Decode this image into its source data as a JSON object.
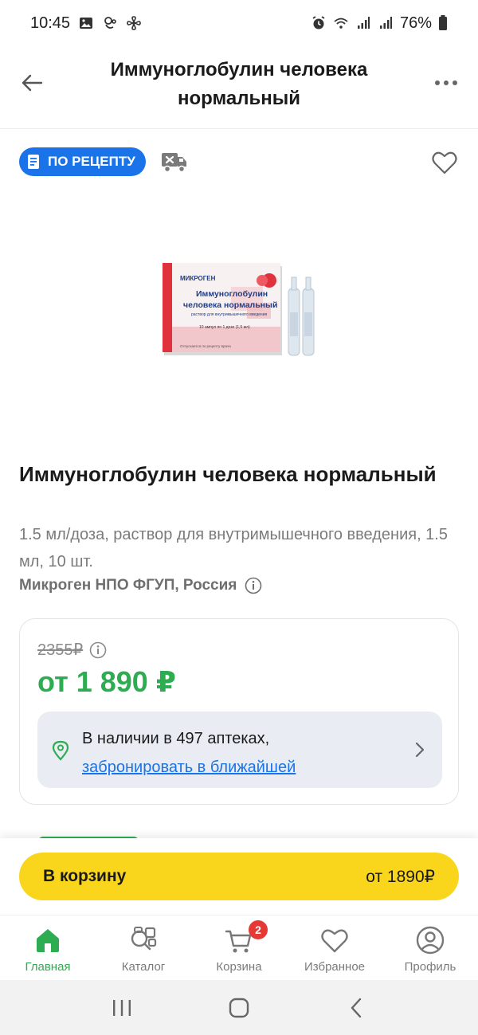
{
  "status_bar": {
    "time": "10:45",
    "battery": "76%"
  },
  "header": {
    "title": "Иммуноглобулин человека нормальный"
  },
  "tags": {
    "prescription_label": "ПО РЕЦЕПТУ"
  },
  "product": {
    "name": "Иммуноглобулин человека нормальный",
    "description": "1.5 мл/доза, раствор для внутримышечного введения, 1.5 мл, 10 шт.",
    "manufacturer": "Микроген НПО ФГУП, Россия",
    "package": {
      "brand": "МИКРОГЕН",
      "line1": "Иммуноглобулин",
      "line2": "человека нормальный",
      "line3": "раствор для внутримышечного введения",
      "line4": "10 ампул по 1 дозе (1,5 мл)",
      "line5": "Отпускается по рецепту врача"
    }
  },
  "price": {
    "old": "2355₽",
    "current": "от 1 890 ₽",
    "availability_text": "В наличии в 497 аптеках,",
    "availability_link": "забронировать в ближайшей"
  },
  "cart_panel": {
    "button_label": "В корзину",
    "button_price": "от 1890₽"
  },
  "bottom_nav": {
    "items": [
      {
        "label": "Главная",
        "icon": "home-icon",
        "active": true
      },
      {
        "label": "Каталог",
        "icon": "catalog-icon"
      },
      {
        "label": "Корзина",
        "icon": "cart-icon",
        "badge": "2"
      },
      {
        "label": "Избранное",
        "icon": "heart-icon"
      },
      {
        "label": "Профиль",
        "icon": "profile-icon"
      }
    ]
  },
  "colors": {
    "accent_green": "#2eac52",
    "accent_blue": "#1a73e8",
    "cart_yellow": "#f9d61c",
    "badge_red": "#e53935"
  }
}
